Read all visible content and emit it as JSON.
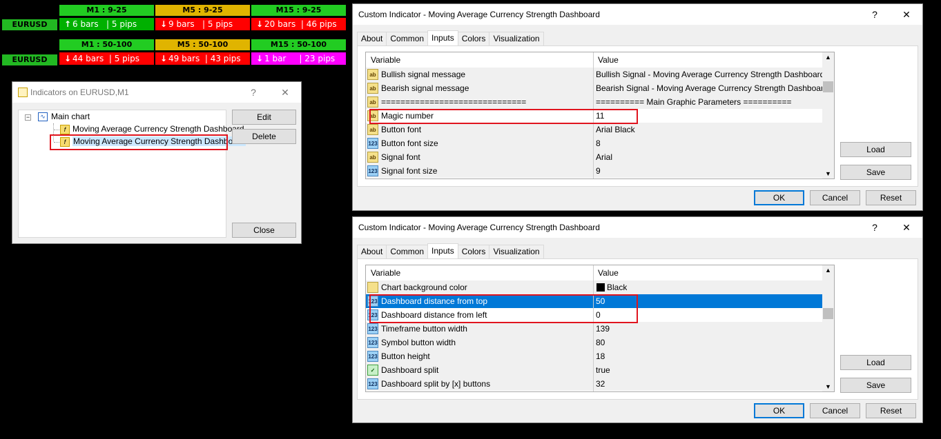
{
  "dashboard": {
    "symbol": "EURUSD",
    "rows": [
      {
        "headers": [
          "M1 : 9-25",
          "M5 : 9-25",
          "M15 : 9-25"
        ],
        "cells": [
          {
            "arrow": "↑",
            "text": "6 bars   | 5 pips",
            "color": "green"
          },
          {
            "arrow": "↓",
            "text": "9 bars   | 5 pips",
            "color": "red"
          },
          {
            "arrow": "↓",
            "text": "20 bars  | 46 pips",
            "color": "red"
          }
        ]
      },
      {
        "headers": [
          "M1 : 50-100",
          "M5 : 50-100",
          "M15 : 50-100"
        ],
        "cells": [
          {
            "arrow": "↓",
            "text": "44 bars  | 5 pips",
            "color": "red"
          },
          {
            "arrow": "↓",
            "text": "49 bars  | 43 pips",
            "color": "red"
          },
          {
            "arrow": "↓",
            "text": "1 bar     | 23 pips",
            "color": "magenta"
          }
        ]
      }
    ]
  },
  "indicators_window": {
    "title": "Indicators on EURUSD,M1",
    "help": "?",
    "close_x": "✕",
    "tree_root": "Main chart",
    "items": [
      "Moving Average Currency Strength Dashboard",
      "Moving Average Currency Strength Dashboard"
    ],
    "edit": "Edit",
    "delete": "Delete",
    "close": "Close"
  },
  "dialog1": {
    "title": "Custom Indicator - Moving Average Currency Strength Dashboard",
    "help": "?",
    "close_x": "✕",
    "tabs": [
      "About",
      "Common",
      "Inputs",
      "Colors",
      "Visualization"
    ],
    "col_variable": "Variable",
    "col_value": "Value",
    "rows": [
      {
        "icon": "ab",
        "variable": "Bullish signal message",
        "value": "Bullish Signal - Moving Average Currency Strength Dashboard"
      },
      {
        "icon": "ab",
        "variable": "Bearish signal message",
        "value": "Bearish Signal - Moving Average Currency Strength Dashboard"
      },
      {
        "icon": "ab",
        "variable": "==============================",
        "value": "========== Main Graphic Parameters =========="
      },
      {
        "icon": "ab",
        "variable": "Magic number",
        "value": "11"
      },
      {
        "icon": "ab",
        "variable": "Button font",
        "value": "Arial Black"
      },
      {
        "icon": "123",
        "variable": "Button font size",
        "value": "8"
      },
      {
        "icon": "ab",
        "variable": "Signal font",
        "value": "Arial"
      },
      {
        "icon": "123",
        "variable": "Signal font size",
        "value": "9"
      }
    ],
    "load": "Load",
    "save": "Save",
    "ok": "OK",
    "cancel": "Cancel",
    "reset": "Reset"
  },
  "dialog2": {
    "title": "Custom Indicator - Moving Average Currency Strength Dashboard",
    "help": "?",
    "close_x": "✕",
    "tabs": [
      "About",
      "Common",
      "Inputs",
      "Colors",
      "Visualization"
    ],
    "col_variable": "Variable",
    "col_value": "Value",
    "rows": [
      {
        "icon": "color",
        "variable": "Chart background color",
        "value": "Black"
      },
      {
        "icon": "123",
        "variable": "Dashboard distance from top",
        "value": "50"
      },
      {
        "icon": "123",
        "variable": "Dashboard distance from left",
        "value": "0"
      },
      {
        "icon": "123",
        "variable": "Timeframe button width",
        "value": "139"
      },
      {
        "icon": "123",
        "variable": "Symbol button width",
        "value": "80"
      },
      {
        "icon": "123",
        "variable": "Button height",
        "value": "18"
      },
      {
        "icon": "bool",
        "variable": "Dashboard split",
        "value": "true"
      },
      {
        "icon": "123",
        "variable": "Dashboard split by [x] buttons",
        "value": "32"
      }
    ],
    "load": "Load",
    "save": "Save",
    "ok": "OK",
    "cancel": "Cancel",
    "reset": "Reset"
  },
  "colors": {
    "green": "#00b000",
    "red": "#ff0000",
    "magenta": "#ff00ff",
    "header_green": "#22cc22",
    "header_yellow": "#e0b400",
    "selection": "#0078d7",
    "highlight": "#e0141e"
  }
}
